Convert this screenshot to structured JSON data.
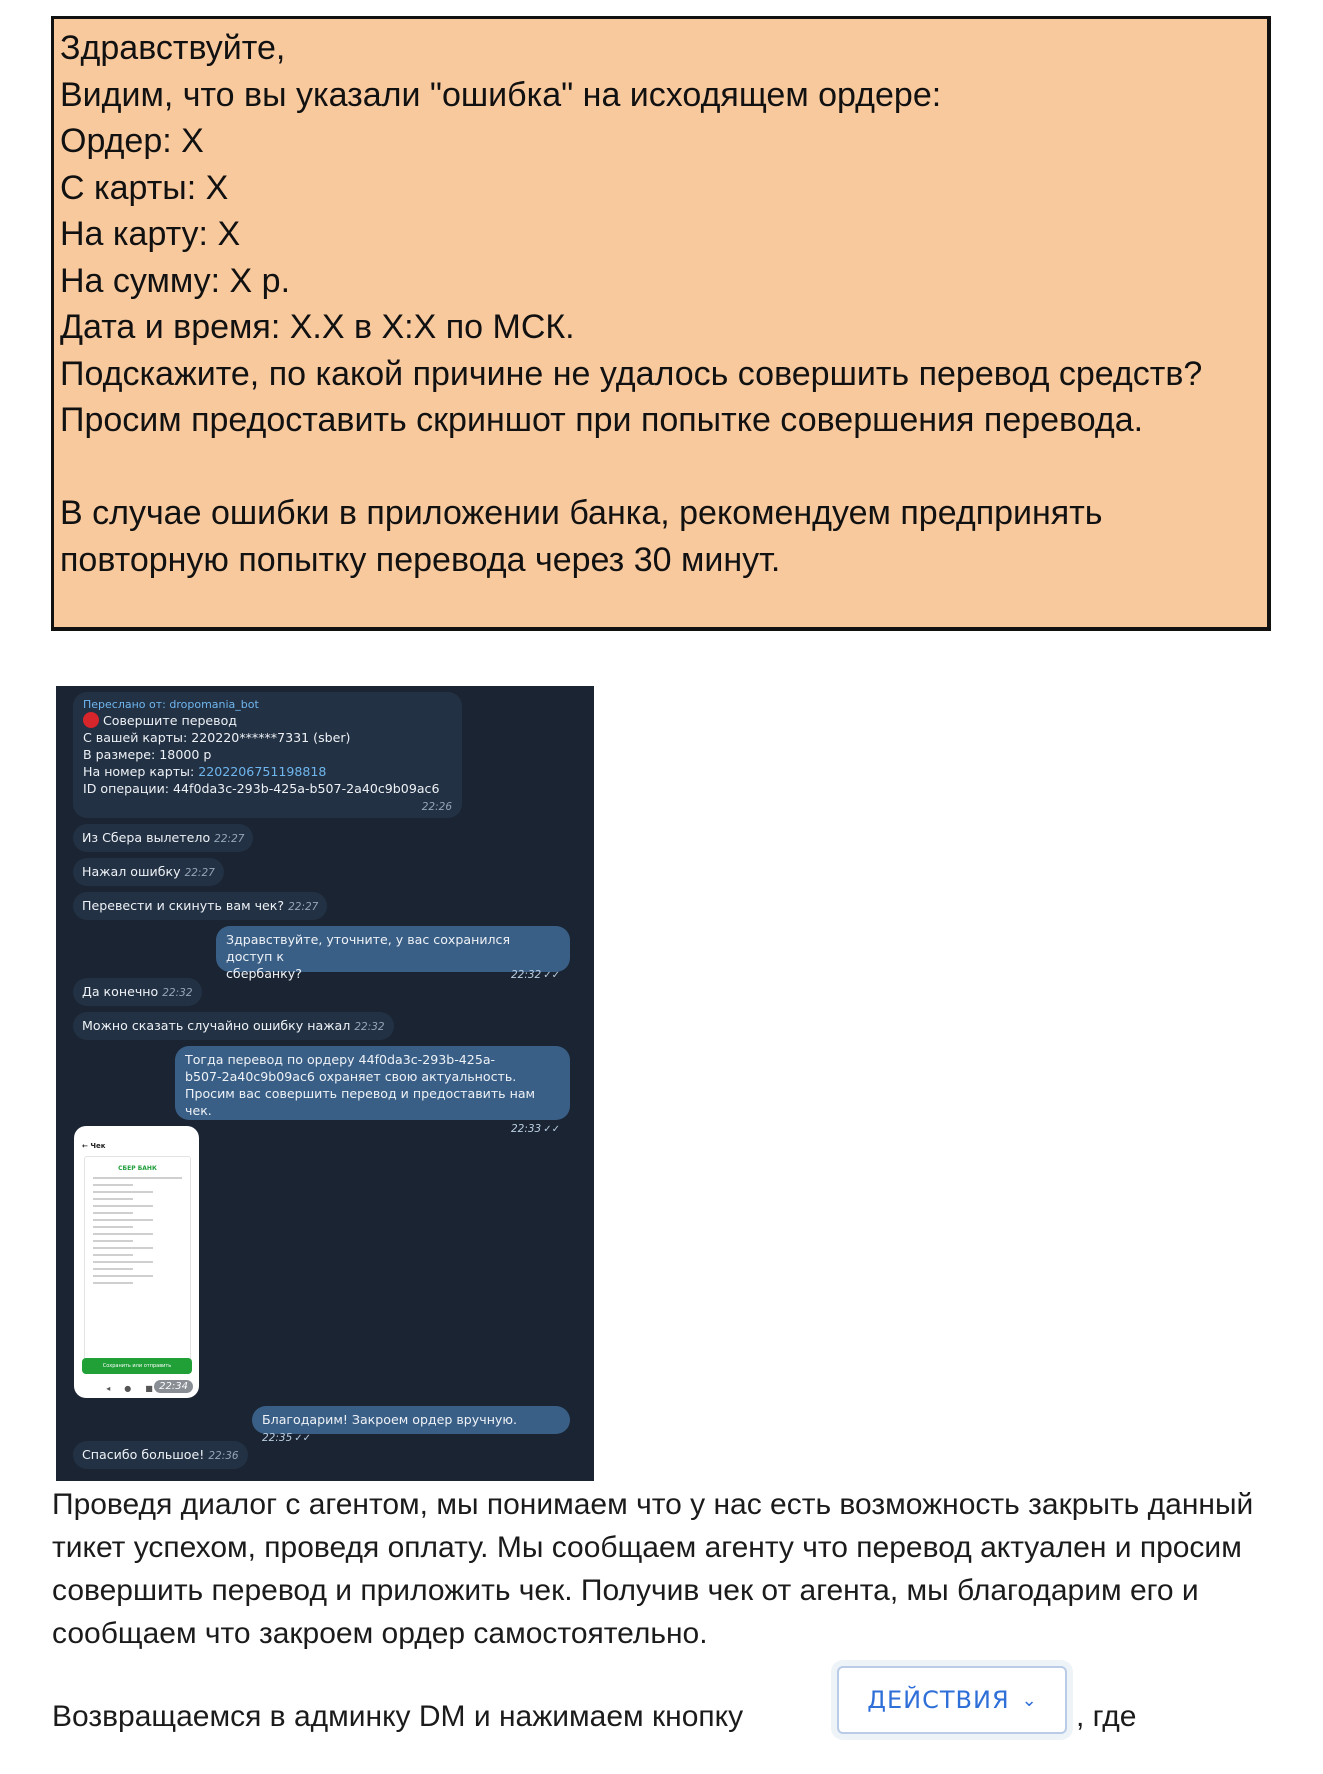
{
  "template": {
    "lines": [
      "Здравствуйте,",
      "Видим, что вы указали \"ошибка\" на исходящем ордере:",
      "Ордер: X",
      "С карты: X",
      "На карту: X",
      "На сумму: X р.",
      "Дата и время: X.X в X:X по МСК.",
      "Подскажите, по какой причине не удалось совершить перевод средств?",
      "Просим предоставить скриншот при попытке совершения перевода.",
      "",
      "В случае ошибки в приложении банка, рекомендуем предпринять",
      "повторную попытку перевода через 30 минут."
    ]
  },
  "chat": {
    "forwarded": {
      "from_label": "Переслано от: dropomania_bot",
      "title": "Совершите перевод",
      "line1": "С вашей карты: 220220******7331 (sber)",
      "line2": "В размере: 18000 р",
      "line3_prefix": "На номер карты: ",
      "line3_link": "2202206751198818",
      "line4": "ID операции: 44f0da3c-293b-425a-b507-2a40c9b09ac6",
      "time": "22:26"
    },
    "messages": [
      {
        "text": "Из Сбера вылетело",
        "time": "22:27"
      },
      {
        "text": "Нажал ошибку",
        "time": "22:27"
      },
      {
        "text": "Перевести и скинуть вам чек?",
        "time": "22:27"
      },
      {
        "line1": "Здравствуйте, уточните, у вас сохранился доступ к",
        "line2": "сбербанку?",
        "time": "22:32",
        "tick": "✓✓"
      },
      {
        "text": "Да конечно",
        "time": "22:32"
      },
      {
        "text": "Можно сказать случайно ошибку нажал",
        "time": "22:32"
      },
      {
        "line1": "Тогда перевод по ордеру 44f0da3c-293b-425a-",
        "line2": "b507-2a40c9b09ac6 охраняет свою актуальность.",
        "line3": "Просим вас совершить перевод и предоставить нам чек.",
        "time": "22:33",
        "tick": "✓✓"
      },
      {
        "text": "Благодарим! Закроем ордер вручную.",
        "time": "22:35",
        "tick": "✓✓"
      },
      {
        "text": "Спасибо большое!",
        "time": "22:36"
      }
    ],
    "receipt_photo": {
      "screen_title": "Чек",
      "bank": "СБЕР БАНК",
      "save_button": "Сохранить или отправить",
      "time": "22:34"
    }
  },
  "body": {
    "paragraph": "Проведя диалог с агентом, мы понимаем что у нас есть возможность закрыть данный тикет успехом, проведя оплату. Мы сообщаем агенту что перевод актуален и просим совершить перевод и приложить чек. Получив чек от агента, мы благодарим его и сообщаем что закроем ордер самостоятельно.",
    "paragraph2_start": "Возвращаемся в админку DM и нажимаем кнопку",
    "paragraph2_end": ", где"
  },
  "actions_button": {
    "label": "ДЕЙСТВИЯ",
    "icon": "chevron-down-icon"
  }
}
